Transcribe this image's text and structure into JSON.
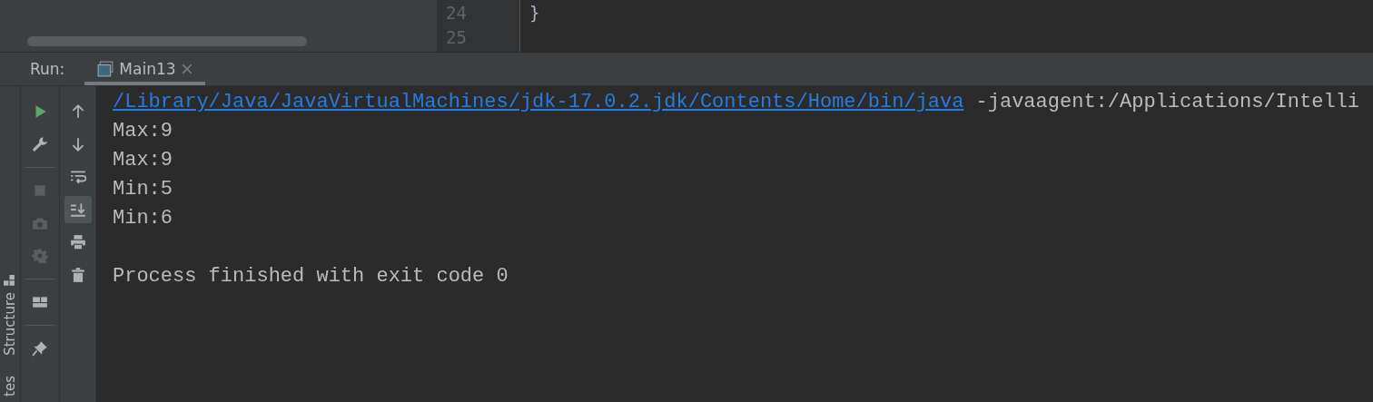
{
  "editor": {
    "line_numbers": [
      "24",
      "25"
    ],
    "code_lines": [
      "}"
    ]
  },
  "run_panel": {
    "label": "Run:",
    "tabs": [
      {
        "label": "Main13",
        "selected": true
      }
    ]
  },
  "side_stripe": {
    "items": [
      {
        "label": "Structure",
        "kind": "structure"
      },
      {
        "label": "tes",
        "kind": "favorites"
      }
    ]
  },
  "run_toolbar": [
    {
      "kind": "run",
      "disabled": false
    },
    {
      "kind": "wrench",
      "disabled": false
    },
    {
      "kind": "divider"
    },
    {
      "kind": "stop",
      "disabled": true
    },
    {
      "kind": "camera",
      "disabled": true
    },
    {
      "kind": "gear",
      "disabled": true
    },
    {
      "kind": "divider"
    },
    {
      "kind": "layout",
      "disabled": false
    },
    {
      "kind": "divider"
    },
    {
      "kind": "pin",
      "disabled": false
    }
  ],
  "console_toolbar": [
    {
      "kind": "up",
      "selected": false
    },
    {
      "kind": "down",
      "selected": false
    },
    {
      "kind": "wrap",
      "selected": false
    },
    {
      "kind": "scroll-end",
      "selected": true
    },
    {
      "kind": "print",
      "selected": false
    },
    {
      "kind": "trash",
      "selected": false
    }
  ],
  "console": {
    "lines": [
      {
        "kind": "command",
        "link": "/Library/Java/JavaVirtualMachines/jdk-17.0.2.jdk/Contents/Home/bin/java",
        "text": " -javaagent:/Applications/Intelli"
      },
      {
        "kind": "output",
        "text": "Max:9"
      },
      {
        "kind": "output",
        "text": "Max:9"
      },
      {
        "kind": "output",
        "text": "Min:5"
      },
      {
        "kind": "output",
        "text": "Min:6"
      },
      {
        "kind": "blank"
      },
      {
        "kind": "output",
        "text": "Process finished with exit code 0"
      }
    ]
  }
}
